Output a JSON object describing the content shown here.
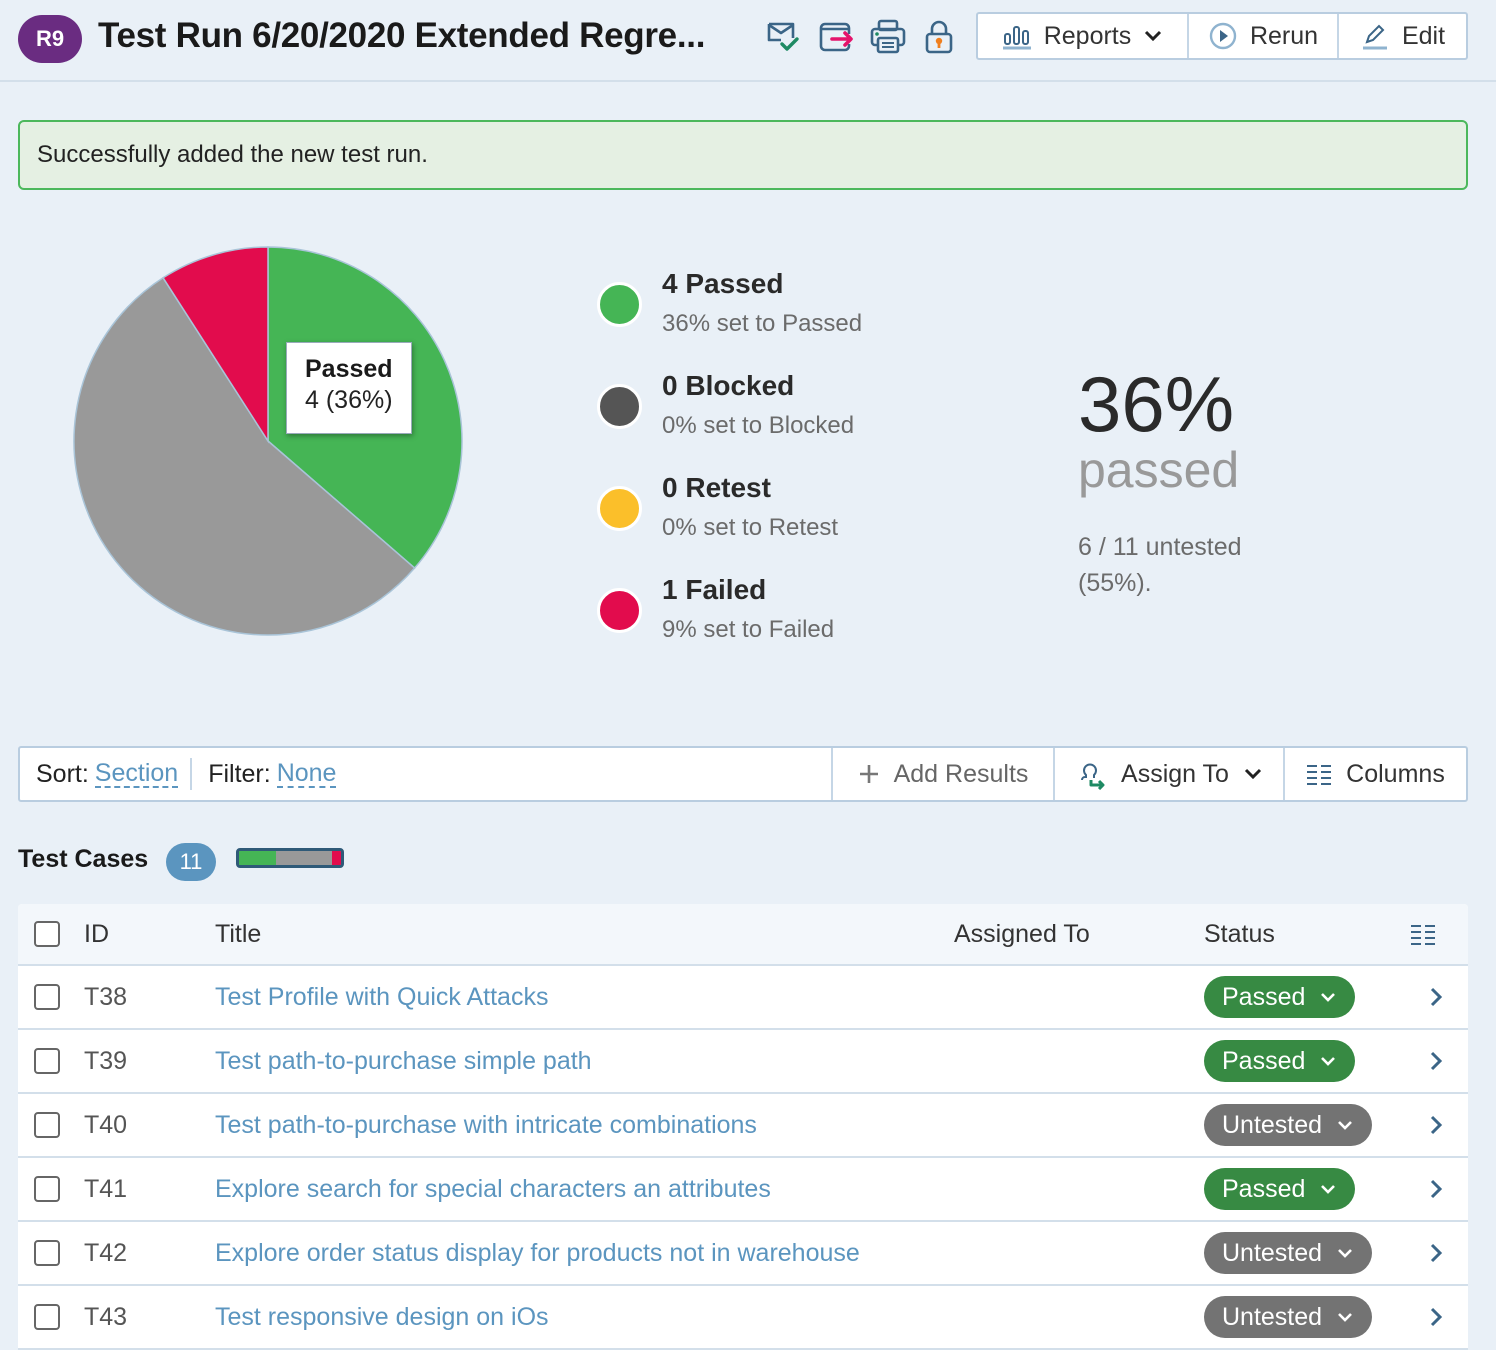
{
  "header": {
    "run_id": "R9",
    "title": "Test Run 6/20/2020 Extended Regre...",
    "icons": [
      "email-check-icon",
      "export-icon",
      "print-icon",
      "lock-icon"
    ],
    "buttons": {
      "reports": "Reports",
      "rerun": "Rerun",
      "edit": "Edit"
    }
  },
  "alert": {
    "message": "Successfully added the new test run."
  },
  "chart_data": {
    "type": "pie",
    "title": "",
    "slices": [
      {
        "label": "Passed",
        "value": 4,
        "percent": 36,
        "color": "#45b555"
      },
      {
        "label": "Untested",
        "value": 6,
        "percent": 55,
        "color": "#999999"
      },
      {
        "label": "Failed",
        "value": 1,
        "percent": 9,
        "color": "#e20c4d"
      },
      {
        "label": "Blocked",
        "value": 0,
        "percent": 0,
        "color": "#555555"
      },
      {
        "label": "Retest",
        "value": 0,
        "percent": 0,
        "color": "#fbbf2a"
      }
    ],
    "order": [
      "Passed",
      "Untested",
      "Failed"
    ],
    "start": "12 o'clock",
    "direction": "clockwise",
    "tooltip": {
      "title": "Passed",
      "value": "4 (36%)"
    }
  },
  "legend": [
    {
      "main": "4 Passed",
      "sub": "36% set to Passed",
      "color": "#45b555"
    },
    {
      "main": "0 Blocked",
      "sub": "0% set to Blocked",
      "color": "#555555"
    },
    {
      "main": "0 Retest",
      "sub": "0% set to Retest",
      "color": "#fbbf2a"
    },
    {
      "main": "1 Failed",
      "sub": "9% set to Failed",
      "color": "#e20c4d"
    }
  ],
  "summary": {
    "percent": "36%",
    "label": "passed",
    "note": "6 / 11 untested (55%)."
  },
  "toolbar": {
    "sort_label": "Sort:",
    "sort_value": "Section",
    "filter_label": "Filter:",
    "filter_value": "None",
    "add_results": "Add Results",
    "assign_to": "Assign To",
    "columns": "Columns"
  },
  "test_cases": {
    "heading": "Test Cases",
    "count": "11",
    "progress": {
      "passed": 36,
      "untested": 55,
      "failed": 9
    },
    "columns": {
      "id": "ID",
      "title": "Title",
      "assigned": "Assigned To",
      "status": "Status"
    },
    "rows": [
      {
        "id": "T38",
        "title": "Test Profile with Quick Attacks",
        "assigned": "",
        "status": "Passed"
      },
      {
        "id": "T39",
        "title": "Test path-to-purchase simple path",
        "assigned": "",
        "status": "Passed"
      },
      {
        "id": "T40",
        "title": "Test path-to-purchase with intricate combinations",
        "assigned": "",
        "status": "Untested"
      },
      {
        "id": "T41",
        "title": "Explore search for special characters an attributes",
        "assigned": "",
        "status": "Passed"
      },
      {
        "id": "T42",
        "title": "Explore order status display for products not in warehouse",
        "assigned": "",
        "status": "Untested"
      },
      {
        "id": "T43",
        "title": "Test responsive design on iOs",
        "assigned": "",
        "status": "Untested"
      }
    ]
  },
  "colors": {
    "passed": "#378a43",
    "untested": "#737373",
    "accent": "#5b95bf",
    "run_badge": "#6a2c81"
  }
}
